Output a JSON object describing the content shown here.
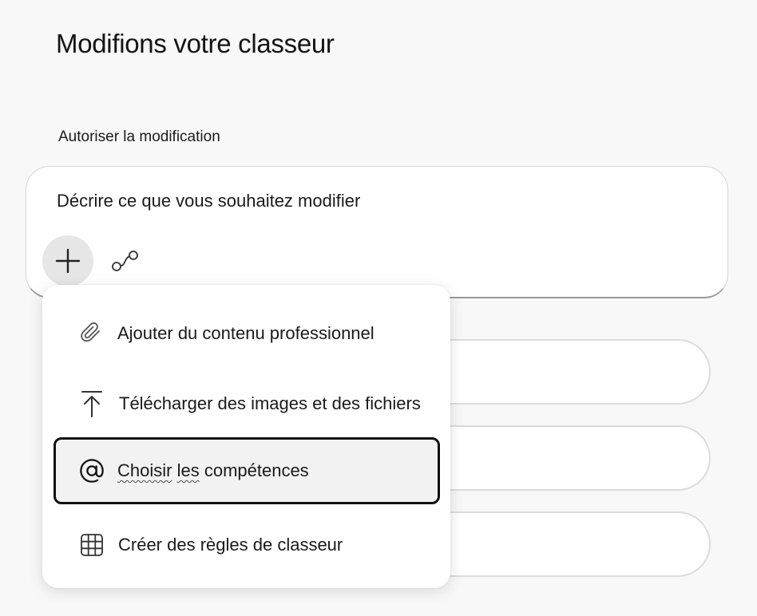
{
  "header": {
    "title": "Modifions votre classeur"
  },
  "section": {
    "label": "Autoriser la modification"
  },
  "prompt": {
    "placeholder": "Décrire ce que vous souhaitez modifier"
  },
  "toolbar": {
    "add_icon": "plus-icon",
    "connect_icon": "connector-icon"
  },
  "menu": {
    "items": [
      {
        "label": "Ajouter du contenu professionnel",
        "icon": "paperclip-icon"
      },
      {
        "label": "Télécharger des images et des fichiers",
        "icon": "upload-icon"
      },
      {
        "label_parts": [
          "Choisir",
          " ",
          "les",
          " compétences"
        ],
        "icon": "at-sign-icon",
        "selected": true
      },
      {
        "label": "Créer des règles de classeur",
        "icon": "table-grid-icon"
      }
    ]
  },
  "colors": {
    "background": "#f8f8f8",
    "surface": "#ffffff",
    "add_button_bg": "#e6e6e6",
    "selected_border": "#111111"
  }
}
